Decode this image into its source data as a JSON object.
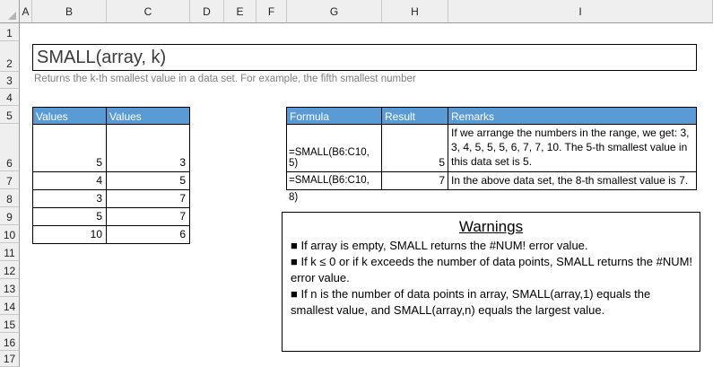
{
  "columns": [
    "A",
    "B",
    "C",
    "D",
    "E",
    "F",
    "G",
    "H",
    "I"
  ],
  "rows": [
    "1",
    "2",
    "3",
    "4",
    "5",
    "6",
    "7",
    "8",
    "9",
    "10",
    "11",
    "12",
    "13",
    "14",
    "15",
    "16",
    "17"
  ],
  "title": "SMALL(array, k)",
  "subtitle": "Returns the k-th smallest value in a data set. For example, the fifth smallest number",
  "values_table": {
    "headers": [
      "Values",
      "Values"
    ],
    "rows": [
      [
        "5",
        "3"
      ],
      [
        "4",
        "5"
      ],
      [
        "3",
        "7"
      ],
      [
        "5",
        "7"
      ],
      [
        "10",
        "6"
      ]
    ]
  },
  "formula_table": {
    "headers": [
      "Formula",
      "Result",
      "Remarks"
    ],
    "rows": [
      {
        "formula": "=SMALL(B6:C10, 5)",
        "result": "5",
        "remarks": "If we arrange the numbers in the range, we get: 3, 3, 4, 5, 5, 5, 6, 7, 7, 10. The 5-th smallest value in this data set is 5."
      },
      {
        "formula": "=SMALL(B6:C10, 8)",
        "result": "7",
        "remarks": "In the above data set, the 8-th smallest value is 7."
      }
    ]
  },
  "warnings": {
    "title": "Warnings",
    "items": [
      "■ If array is empty, SMALL returns the #NUM! error value.",
      "■ If k ≤ 0 or if k exceeds the number of data points, SMALL returns the #NUM! error value.",
      "■ If n is the number of data points in array, SMALL(array,1) equals the smallest value, and SMALL(array,n) equals the largest value."
    ]
  }
}
